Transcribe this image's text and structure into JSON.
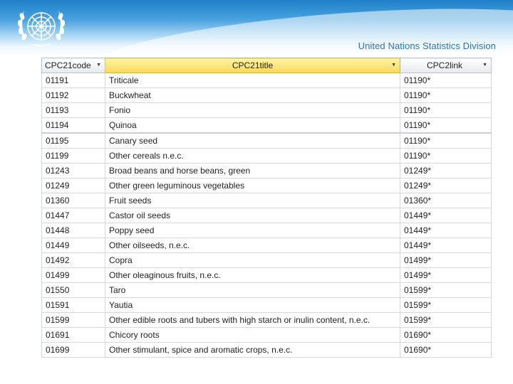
{
  "header": {
    "division": "United Nations Statistics Division"
  },
  "table": {
    "columns": [
      "CPC21code",
      "CPC21title",
      "CPC2link"
    ],
    "rows": [
      [
        "01191",
        "Triticale",
        "01190*"
      ],
      [
        "01192",
        "Buckwheat",
        "01190*"
      ],
      [
        "01193",
        "Fonio",
        "01190*"
      ],
      [
        "01194",
        "Quinoa",
        "01190*"
      ],
      [
        "01195",
        "Canary seed",
        "01190*"
      ],
      [
        "01199",
        "Other cereals n.e.c.",
        "01190*"
      ],
      [
        "01243",
        "Broad beans and horse beans, green",
        "01249*"
      ],
      [
        "01249",
        "Other green leguminous vegetables",
        "01249*"
      ],
      [
        "01360",
        "Fruit seeds",
        "01360*"
      ],
      [
        "01447",
        "Castor oil seeds",
        "01449*"
      ],
      [
        "01448",
        "Poppy seed",
        "01449*"
      ],
      [
        "01449",
        "Other oilseeds, n.e.c.",
        "01449*"
      ],
      [
        "01492",
        "Copra",
        "01499*"
      ],
      [
        "01499",
        "Other oleaginous fruits, n.e.c.",
        "01499*"
      ],
      [
        "01550",
        "Taro",
        "01599*"
      ],
      [
        "01591",
        "Yautia",
        "01599*"
      ],
      [
        "01599",
        "Other edible roots and tubers with high starch or inulin content, n.e.c.",
        "01599*"
      ],
      [
        "01691",
        "Chicory roots",
        "01690*"
      ],
      [
        "01699",
        "Other stimulant, spice and aromatic crops, n.e.c.",
        "01690*"
      ]
    ]
  }
}
